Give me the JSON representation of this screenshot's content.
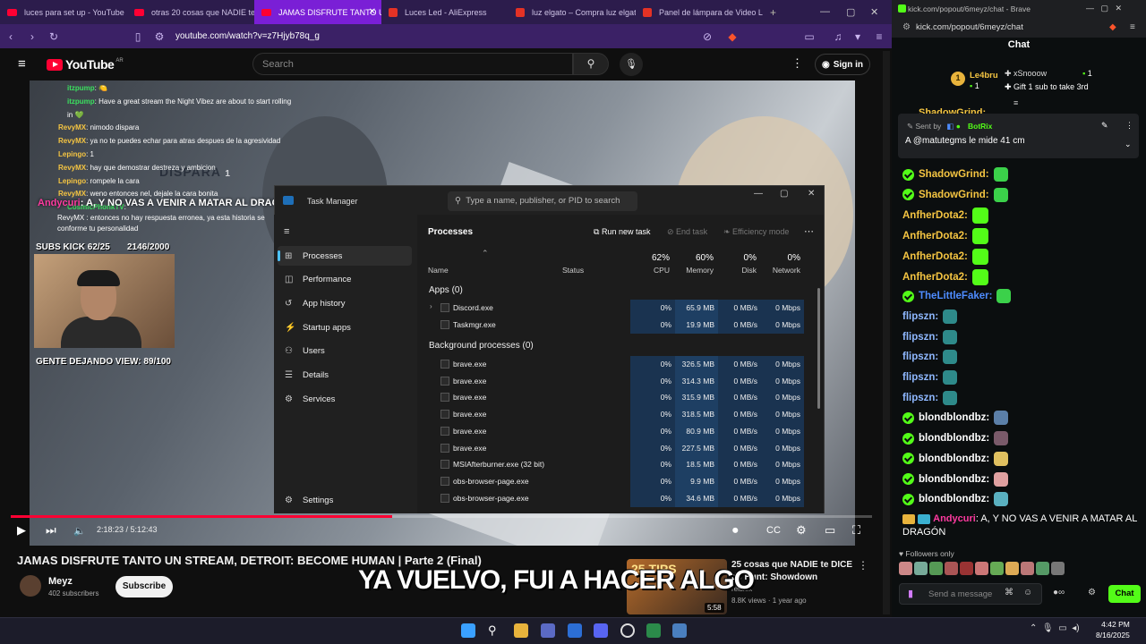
{
  "browser": {
    "tabs": [
      {
        "label": "luces para set up - YouTube",
        "type": "yt"
      },
      {
        "label": "otras 20 cosas que NADIE te D",
        "type": "yt"
      },
      {
        "label": "JAMAS DISFRUTE TANTO U",
        "type": "yt",
        "active": true
      },
      {
        "label": "Luces Led - AliExpress",
        "type": "ali"
      },
      {
        "label": "luz elgato – Compra luz elgato",
        "type": "ali"
      },
      {
        "label": "Panel de lámpara de Video Le",
        "type": "ali"
      }
    ],
    "url": "youtube.com/watch?v=z7Hjyb78q_g"
  },
  "youtube": {
    "logo": "YouTube",
    "region": "AR",
    "search_placeholder": "Search",
    "signin": "Sign in",
    "video_title": "JAMAS DISFRUTE TANTO UN STREAM, DETROIT: BECOME HUMAN | Parte 2 (Final)",
    "channel": "Meyz",
    "subscribers": "402 subscribers",
    "subscribe": "Subscribe",
    "time": "2:18:23 / 5:12:43",
    "progress": 0.443,
    "caption": "YA VUELVO, FUI A HACER ALGO",
    "suggested": {
      "title": "25 cosas que NADIE te DICE de Hunt: Showdown",
      "channel": "reislek",
      "meta": "8.8K views · 1 year ago",
      "duration": "5:58",
      "thumb_text": "25 TIPS"
    }
  },
  "overlay": {
    "chat": [
      {
        "user": "itzpump",
        "msg": ": 🍋",
        "color": "g"
      },
      {
        "user": "itzpump",
        "msg": ": Have a great stream the Night Vibez are about to start rolling in 💚",
        "color": "g"
      },
      {
        "user": "RevyMX",
        "msg": ": nimodo dispara",
        "color": "n"
      },
      {
        "user": "RevyMX",
        "msg": ": ya no te puedes echar para atras despues de la agresividad",
        "color": "n"
      },
      {
        "user": "Lepingo",
        "msg": ": 1",
        "color": "n"
      },
      {
        "user": "RevyMX",
        "msg": ": hay que demostrar destreza y ambicion",
        "color": "n"
      },
      {
        "user": "Lepingo",
        "msg": ": rompele la cara",
        "color": "n"
      },
      {
        "user": "RevyMX",
        "msg": ": weno entonces nel, dejale la cara bonita",
        "color": "n"
      },
      {
        "user": "CosmicPhonkTV",
        "msg": ": ",
        "color": "g"
      }
    ],
    "big_user": "Andycuri",
    "big_msg": ": A, Y NO VAS A VENIR A MATAR AL DRAGÓN",
    "after_big": "RevyMX : entonces no hay respuesta erronea, ya esta historia se conforme tu personalidad",
    "subs_label": "SUBS KICK 62/25",
    "subs_goal": "2146/2000",
    "view_label": "GENTE DEJANDO VIEW: 89/100",
    "scene_text": "DISPARA",
    "scene_num": "1"
  },
  "taskmanager": {
    "title": "Task Manager",
    "search_placeholder": "Type a name, publisher, or PID to search",
    "nav": [
      "Processes",
      "Performance",
      "App history",
      "Startup apps",
      "Users",
      "Details",
      "Services"
    ],
    "settings": "Settings",
    "heading": "Processes",
    "run_new": "Run new task",
    "end_task": "End task",
    "efficiency": "Efficiency mode",
    "columns": {
      "name": "Name",
      "status": "Status",
      "cpu": "CPU",
      "memory": "Memory",
      "disk": "Disk",
      "network": "Network"
    },
    "totals": {
      "cpu": "62%",
      "memory": "60%",
      "disk": "0%",
      "network": "0%"
    },
    "apps_label": "Apps (0)",
    "bg_label": "Background processes (0)",
    "apps": [
      {
        "name": "Discord.exe",
        "cpu": "0%",
        "mem": "65.9 MB",
        "disk": "0 MB/s",
        "net": "0 Mbps",
        "expand": true
      },
      {
        "name": "Taskmgr.exe",
        "cpu": "0%",
        "mem": "19.9 MB",
        "disk": "0 MB/s",
        "net": "0 Mbps"
      }
    ],
    "bg": [
      {
        "name": "brave.exe",
        "cpu": "0%",
        "mem": "326.5 MB",
        "disk": "0 MB/s",
        "net": "0 Mbps"
      },
      {
        "name": "brave.exe",
        "cpu": "0%",
        "mem": "314.3 MB",
        "disk": "0 MB/s",
        "net": "0 Mbps"
      },
      {
        "name": "brave.exe",
        "cpu": "0%",
        "mem": "315.9 MB",
        "disk": "0 MB/s",
        "net": "0 Mbps"
      },
      {
        "name": "brave.exe",
        "cpu": "0%",
        "mem": "318.5 MB",
        "disk": "0 MB/s",
        "net": "0 Mbps"
      },
      {
        "name": "brave.exe",
        "cpu": "0%",
        "mem": "80.9 MB",
        "disk": "0 MB/s",
        "net": "0 Mbps"
      },
      {
        "name": "brave.exe",
        "cpu": "0%",
        "mem": "227.5 MB",
        "disk": "0 MB/s",
        "net": "0 Mbps"
      },
      {
        "name": "MSIAfterburner.exe (32 bit)",
        "cpu": "0%",
        "mem": "18.5 MB",
        "disk": "0 MB/s",
        "net": "0 Mbps"
      },
      {
        "name": "obs-browser-page.exe",
        "cpu": "0%",
        "mem": "9.9 MB",
        "disk": "0 MB/s",
        "net": "0 Mbps"
      },
      {
        "name": "obs-browser-page.exe",
        "cpu": "0%",
        "mem": "34.6 MB",
        "disk": "0 MB/s",
        "net": "0 Mbps"
      }
    ]
  },
  "kick": {
    "window_title": "kick.com/popout/6meyz/chat - Brave",
    "url": "kick.com/popout/6meyz/chat",
    "header": "Chat",
    "leader1_name": "Le4bru",
    "leader1_count": "1",
    "leader2": "xSnooow",
    "leader2_count": "1",
    "gift": "Gift 1 sub to take 3rd",
    "pinned_by": "Sent by",
    "pinned_bot": "BotRix",
    "pinned_msg": "A @matutegms le mide 41 cm",
    "peek_name": "ShadowGrind:",
    "messages": [
      {
        "user": "ShadowGrind:",
        "color": "#f5c542",
        "verified": true,
        "emote": "#3bd14a"
      },
      {
        "user": "ShadowGrind:",
        "color": "#f5c542",
        "verified": true,
        "emote": "#3bd14a"
      },
      {
        "user": "AnfherDota2:",
        "color": "#f5c542",
        "verified": false,
        "emote": "kick"
      },
      {
        "user": "AnfherDota2:",
        "color": "#f5c542",
        "verified": false,
        "emote": "kick"
      },
      {
        "user": "AnfherDota2:",
        "color": "#f5c542",
        "verified": false,
        "emote": "kick"
      },
      {
        "user": "AnfherDota2:",
        "color": "#f5c542",
        "verified": false,
        "emote": "kick"
      },
      {
        "user": "TheLittleFaker:",
        "color": "#4e8cff",
        "verified": true,
        "emote": "#3bd14a"
      },
      {
        "user": "flipszn:",
        "color": "#8fb8ff",
        "verified": false,
        "emote": "#2e8a8a"
      },
      {
        "user": "flipszn:",
        "color": "#8fb8ff",
        "verified": false,
        "emote": "#2e8a8a"
      },
      {
        "user": "flipszn:",
        "color": "#8fb8ff",
        "verified": false,
        "emote": "#2e8a8a"
      },
      {
        "user": "flipszn:",
        "color": "#8fb8ff",
        "verified": false,
        "emote": "#2e8a8a"
      },
      {
        "user": "flipszn:",
        "color": "#8fb8ff",
        "verified": false,
        "emote": "#2e8a8a"
      },
      {
        "user": "blondblondbz:",
        "color": "#ffffff",
        "verified": true,
        "emote": "#5b7fa8"
      },
      {
        "user": "blondblondbz:",
        "color": "#ffffff",
        "verified": true,
        "emote": "#7a5a6a"
      },
      {
        "user": "blondblondbz:",
        "color": "#ffffff",
        "verified": true,
        "emote": "#e0c060"
      },
      {
        "user": "blondblondbz:",
        "color": "#ffffff",
        "verified": true,
        "emote": "#e0a0a0"
      },
      {
        "user": "blondblondbz:",
        "color": "#ffffff",
        "verified": true,
        "emote": "#5ab0c0"
      }
    ],
    "last_user": "Andycuri",
    "last_msg": ": A, Y NO VAS A VENIR A MATAR AL DRAGÓN",
    "followers_only": "Followers only",
    "input_placeholder": "Send a message",
    "chat_button": "Chat"
  },
  "taskbar": {
    "time": "4:42 PM",
    "date": "8/16/2025"
  },
  "colors": {
    "kick_green": "#53fc18",
    "yt_red": "#ff0033",
    "brave_purple": "#7a1fd6"
  }
}
